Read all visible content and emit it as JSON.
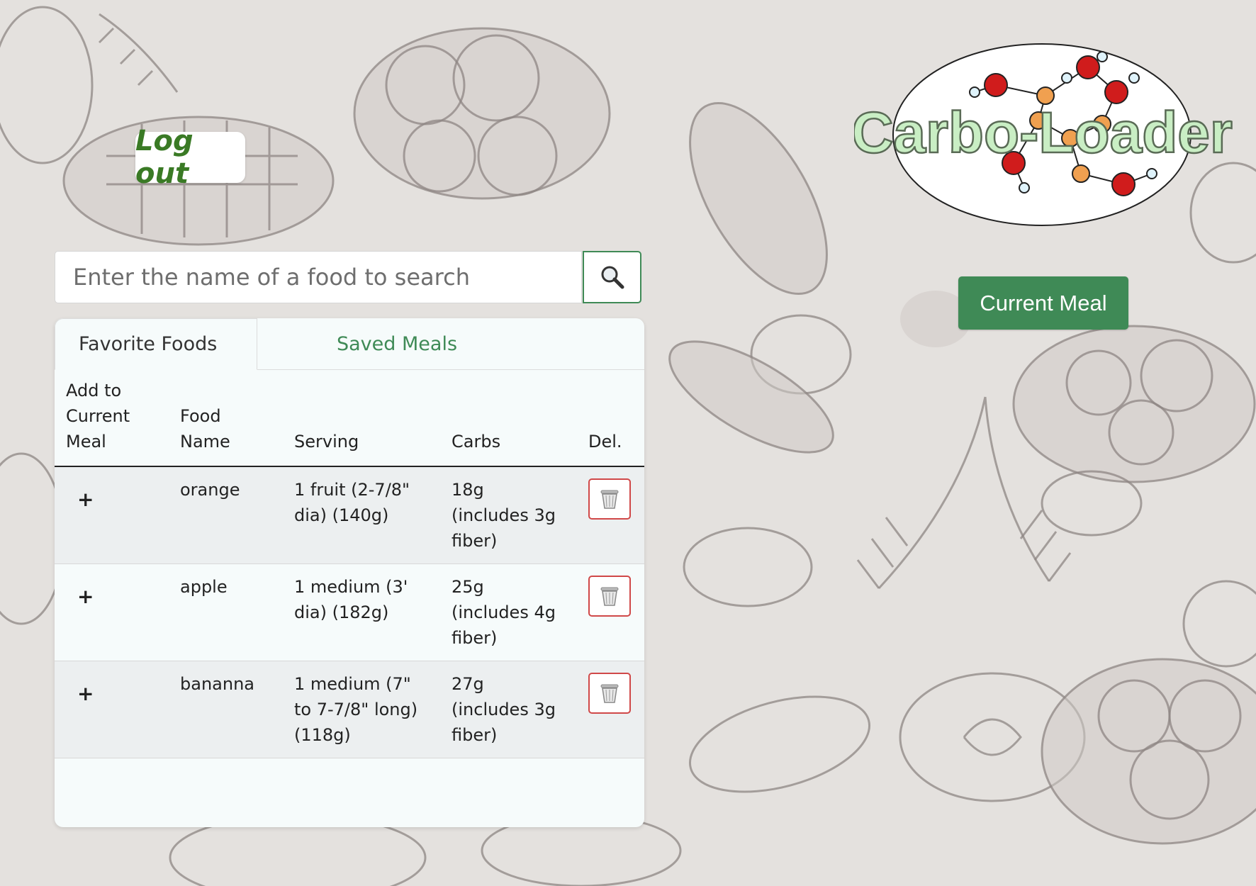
{
  "header": {
    "logout_label": "Log out",
    "logo_text": "Carbo-Loader",
    "current_meal_label": "Current Meal"
  },
  "search": {
    "placeholder": "Enter the name of a food to search",
    "value": "",
    "button_icon": "magnifier-icon"
  },
  "tabs": [
    {
      "label": "Favorite Foods",
      "active": true
    },
    {
      "label": "Saved Meals",
      "active": false
    }
  ],
  "table": {
    "headers": {
      "add": "Add to Current Meal",
      "name": "Food Name",
      "serving": "Serving",
      "carbs": "Carbs",
      "del": "Del."
    },
    "rows": [
      {
        "add": "+",
        "name": "orange",
        "serving": "1 fruit (2-7/8\" dia) (140g)",
        "carbs": "18g (includes 3g fiber)",
        "del_icon": "trash-icon"
      },
      {
        "add": "+",
        "name": "apple",
        "serving": "1 medium (3' dia) (182g)",
        "carbs": "25g (includes 4g fiber)",
        "del_icon": "trash-icon"
      },
      {
        "add": "+",
        "name": "bananna",
        "serving": "1 medium (7\" to 7-7/8\" long) (118g)",
        "carbs": "27g (includes 3g fiber)",
        "del_icon": "trash-icon"
      }
    ]
  },
  "colors": {
    "accent_green": "#3f8a56",
    "logout_text": "#3a7a25",
    "delete_border": "#d04848",
    "background": "#e4e1de"
  }
}
